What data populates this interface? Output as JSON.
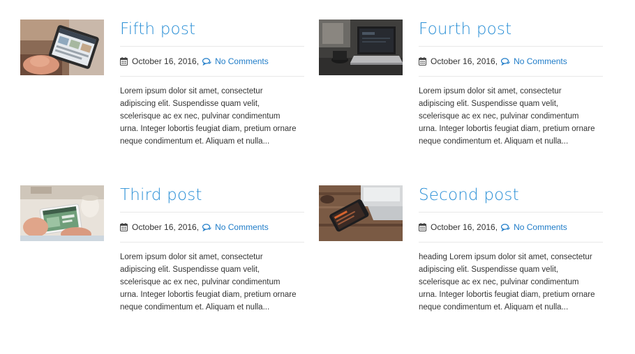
{
  "posts": [
    {
      "title": "Fifth post",
      "date": "October 16, 2016,",
      "comments": "No Comments",
      "excerpt": "Lorem ipsum dolor sit amet, consectetur adipiscing elit. Suspendisse quam velit, scelerisque ac ex nec, pulvinar condimentum urna. Integer lobortis feugiat diam, pretium ornare neque condimentum et. Aliquam et nulla..."
    },
    {
      "title": "Fourth post",
      "date": "October 16, 2016,",
      "comments": "No Comments",
      "excerpt": "Lorem ipsum dolor sit amet, consectetur adipiscing elit. Suspendisse quam velit, scelerisque ac ex nec, pulvinar condimentum urna. Integer lobortis feugiat diam, pretium ornare neque condimentum et. Aliquam et nulla..."
    },
    {
      "title": "Third post",
      "date": "October 16, 2016,",
      "comments": "No Comments",
      "excerpt": "Lorem ipsum dolor sit amet, consectetur adipiscing elit. Suspendisse quam velit, scelerisque ac ex nec, pulvinar condimentum urna. Integer lobortis feugiat diam, pretium ornare neque condimentum et. Aliquam et nulla..."
    },
    {
      "title": "Second post",
      "date": "October 16, 2016,",
      "comments": "No Comments",
      "excerpt": "heading Lorem ipsum dolor sit amet, consectetur adipiscing elit. Suspendisse quam velit, scelerisque ac ex nec, pulvinar condimentum urna. Integer lobortis feugiat diam, pretium ornare neque condimentum et. Aliquam et nulla..."
    }
  ],
  "colors": {
    "title": "#2a8fd6",
    "link": "#1f7cc8",
    "text": "#333333",
    "divider": "#e8e8e8"
  },
  "icons": {
    "date": "calendar-icon",
    "comments": "comment-icon"
  }
}
